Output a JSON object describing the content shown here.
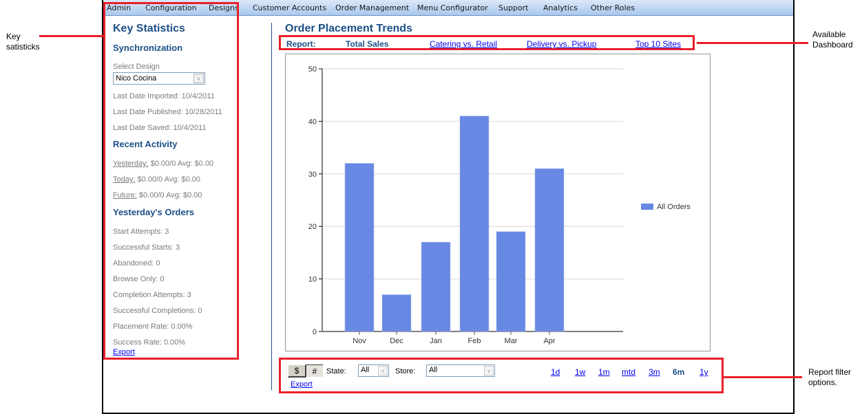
{
  "menu": {
    "items": [
      {
        "label": "Admin"
      },
      {
        "label": "Configuration"
      },
      {
        "label": "Designs"
      },
      {
        "label": "Customer Accounts"
      },
      {
        "label": "Order Management"
      },
      {
        "label": "Menu Configurator"
      },
      {
        "label": "Support"
      },
      {
        "label": "Analytics"
      },
      {
        "label": "Other Roles"
      }
    ]
  },
  "left_panel": {
    "title": "Key Statistics",
    "sync": {
      "heading": "Synchronization",
      "select_label": "Select Design",
      "select_value": "Nico Cocina",
      "last_imported": "Last Date Imported: 10/4/2011",
      "last_published": "Last Date Published: 10/28/2011",
      "last_saved": "Last Date Saved: 10/4/2011"
    },
    "recent": {
      "heading": "Recent Activity",
      "rows": [
        {
          "label": "Yesterday:",
          "value": " $0.00/0 Avg: $0.00"
        },
        {
          "label": "Today:",
          "value": " $0.00/0 Avg: $0.00"
        },
        {
          "label": "Future:",
          "value": " $0.00/0 Avg: $0.00"
        }
      ]
    },
    "yesterday": {
      "heading": "Yesterday's Orders",
      "rows": [
        "Start Attempts: 3",
        "Successful Starts: 3",
        "Abandoned: 0",
        "Browse Only: 0",
        "Completion Attempts: 3",
        "Successful Completions: 0",
        "Placement Rate: 0.00%",
        "Success Rate: 0.00%"
      ]
    },
    "export_label": "Export"
  },
  "main": {
    "title": "Order Placement Trends",
    "report_label": "Report:",
    "report_active": "Total Sales",
    "report_links": [
      "Catering vs. Retail",
      "Delivery vs. Pickup",
      "Top 10 Sites"
    ]
  },
  "chart_data": {
    "type": "bar",
    "title": "",
    "xlabel": "",
    "ylabel": "",
    "categories": [
      "Nov",
      "Dec",
      "Jan",
      "Feb",
      "Mar",
      "Apr"
    ],
    "series": [
      {
        "name": "All Orders",
        "values": [
          32,
          7,
          17,
          41,
          19,
          31
        ],
        "color": "#6788e3"
      }
    ],
    "ylim": [
      0,
      50
    ],
    "yticks": [
      0,
      10,
      20,
      30,
      40,
      50
    ],
    "grid": true,
    "legend": "right"
  },
  "filters": {
    "dollar_label": "$",
    "hash_label": "#",
    "state_label": "State:",
    "state_value": "All",
    "store_label": "Store:",
    "store_value": "All",
    "export_label": "Export",
    "ranges": [
      {
        "label": "1d",
        "active": false
      },
      {
        "label": "1w",
        "active": false
      },
      {
        "label": "1m",
        "active": false
      },
      {
        "label": "mtd",
        "active": false
      },
      {
        "label": "3m",
        "active": false
      },
      {
        "label": "6m",
        "active": true
      },
      {
        "label": "1y",
        "active": false
      }
    ]
  },
  "annotations": {
    "key_stats": "Key satisticks",
    "dashboard": "Available Dashboard",
    "filters": "Report filter options."
  },
  "colors": {
    "heading": "#1b4f86",
    "bar": "#6788e3",
    "annotation": "#e8202a"
  }
}
